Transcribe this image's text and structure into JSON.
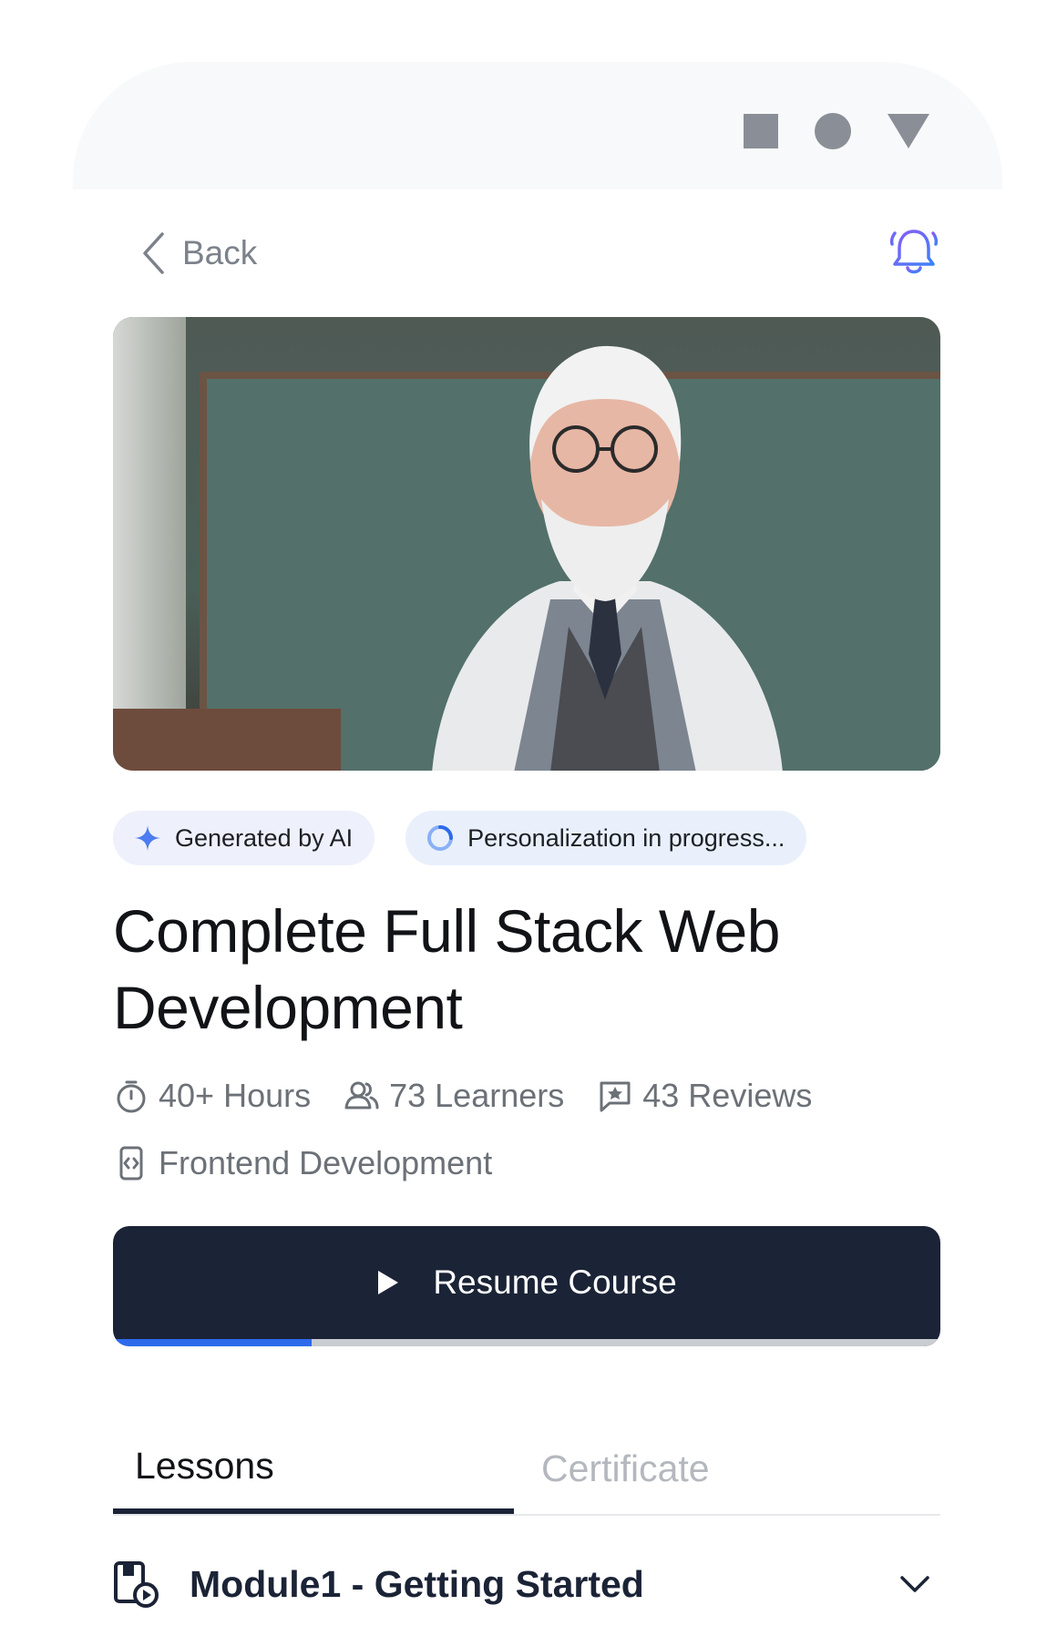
{
  "status_bar": {
    "icons": [
      "square-icon",
      "circle-icon",
      "triangle-icon"
    ]
  },
  "topbar": {
    "back_label": "Back",
    "icons": [
      "chevron-left-icon",
      "bell-icon"
    ]
  },
  "hero": {
    "alt": "AI instructor portrait"
  },
  "badges": {
    "ai_label": "Generated by AI",
    "personalization_label": "Personalization in progress..."
  },
  "course": {
    "title": "Complete Full Stack Web Development",
    "hours": "40+ Hours",
    "learners": "73 Learners",
    "reviews": "43 Reviews",
    "category": "Frontend Development"
  },
  "resume_button": {
    "label": "Resume Course",
    "progress": 0.24
  },
  "tabs": [
    {
      "label": "Lessons",
      "active": true
    },
    {
      "label": "Certificate",
      "active": false
    }
  ],
  "modules": [
    {
      "title": "Module1 - Getting Started"
    }
  ],
  "colors": {
    "primary": "#1b2336",
    "accent": "#2e6bea",
    "muted": "#6c7178"
  }
}
